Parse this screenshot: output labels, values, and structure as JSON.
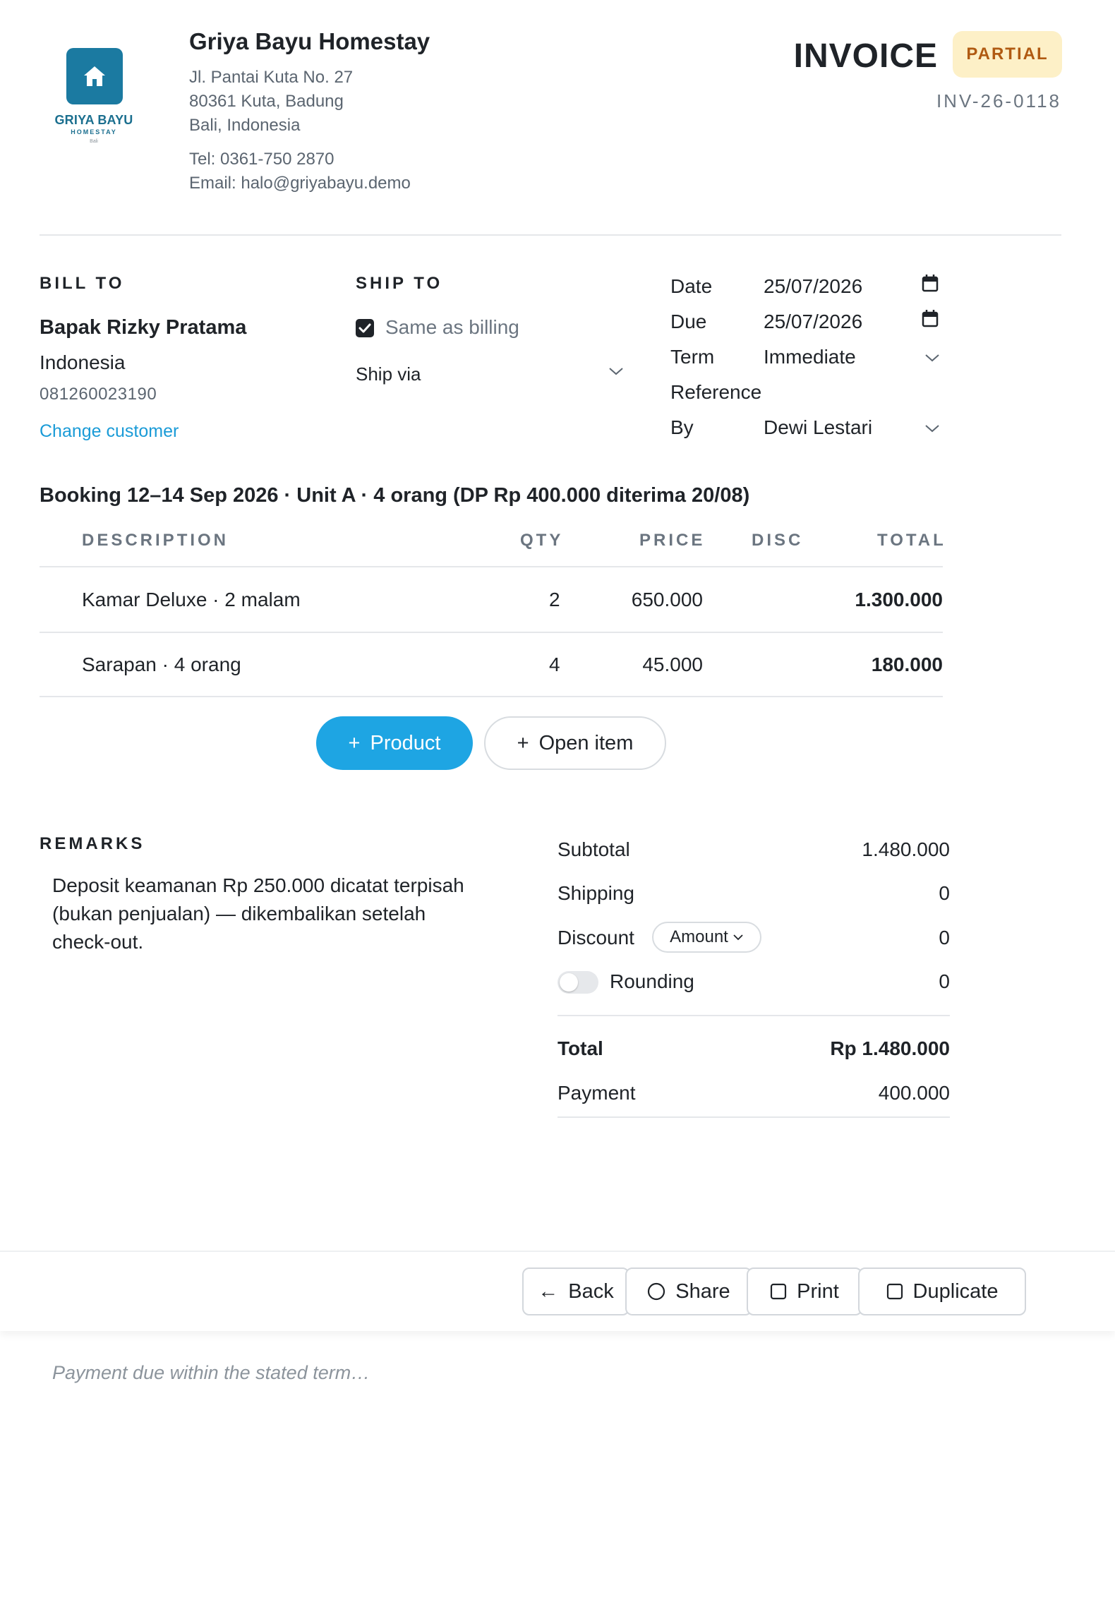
{
  "company": {
    "logo_text": "GRIYA BAYU",
    "logo_sub": "HOMESTAY",
    "logo_location": "Bali",
    "name": "Griya Bayu Homestay",
    "address1": "Jl. Pantai Kuta No. 27",
    "address2": "80361 Kuta, Badung",
    "address3": "Bali, Indonesia",
    "tel": "Tel: 0361-750 2870",
    "email": "Email: halo@griyabayu.demo"
  },
  "invoice": {
    "title": "INVOICE",
    "status": "PARTIAL",
    "number": "INV-26-0118"
  },
  "bill_to": {
    "label": "BILL TO",
    "name": "Bapak Rizky Pratama",
    "country": "Indonesia",
    "phone": "081260023190",
    "change_link": "Change customer"
  },
  "ship_to": {
    "label": "SHIP TO",
    "same_as_billing": "Same as billing",
    "ship_via": "Ship via"
  },
  "meta": {
    "date_label": "Date",
    "date_value": "25/07/2026",
    "due_label": "Due",
    "due_value": "25/07/2026",
    "term_label": "Term",
    "term_value": "Immediate",
    "reference_label": "Reference",
    "reference_value": "",
    "by_label": "By",
    "by_value": "Dewi Lestari"
  },
  "booking_note": "Booking 12–14 Sep 2026 · Unit A · 4 orang (DP Rp 400.000 diterima 20/08)",
  "table": {
    "headers": {
      "description": "DESCRIPTION",
      "qty": "QTY",
      "price": "PRICE",
      "disc": "DISC",
      "total": "TOTAL"
    },
    "rows": [
      {
        "description": "Kamar Deluxe · 2 malam",
        "qty": "2",
        "price": "650.000",
        "disc": "",
        "total": "1.300.000"
      },
      {
        "description": "Sarapan · 4 orang",
        "qty": "4",
        "price": "45.000",
        "disc": "",
        "total": "180.000"
      }
    ]
  },
  "actions": {
    "product": "Product",
    "open_item": "Open item"
  },
  "remarks": {
    "label": "REMARKS",
    "text": "Deposit keamanan Rp 250.000 dicatat terpisah (bukan penjualan) — dikembalikan setelah check-out."
  },
  "totals": {
    "subtotal_label": "Subtotal",
    "subtotal_value": "1.480.000",
    "shipping_label": "Shipping",
    "shipping_value": "0",
    "discount_label": "Discount",
    "discount_mode": "Amount",
    "discount_value": "0",
    "rounding_label": "Rounding",
    "rounding_value": "0",
    "total_label": "Total",
    "total_value": "Rp 1.480.000",
    "payment_label": "Payment",
    "payment_value": "400.000"
  },
  "footer": {
    "back": "Back",
    "share": "Share",
    "print": "Print",
    "duplicate": "Duplicate",
    "note_placeholder": "Payment due within the stated term…"
  },
  "colors": {
    "brand": "#1b7aa1",
    "accent": "#1ea5e3",
    "badge_bg": "#fdf0c7",
    "badge_text": "#b05a12",
    "link": "#1a9bd7"
  },
  "icons": [
    "home-icon",
    "calendar-icon",
    "chevron-down-icon",
    "checkbox-checked-icon",
    "plus-icon",
    "arrow-left-icon",
    "circle-icon",
    "square-icon"
  ]
}
